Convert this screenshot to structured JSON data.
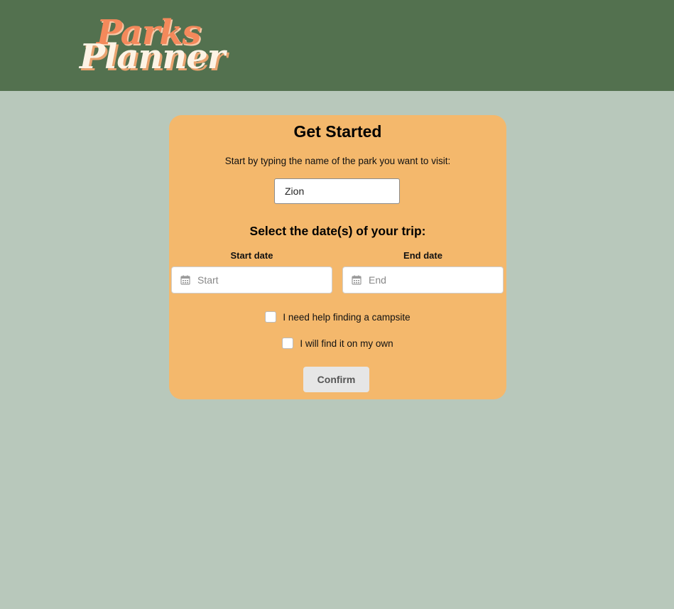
{
  "header": {
    "logo_line1": "Parks",
    "logo_line2": "Planner",
    "background_color": "#53714f"
  },
  "card": {
    "title": "Get Started",
    "subtitle": "Start by typing the name of the park you want to visit:",
    "park_input_value": "Zion",
    "dates_heading": "Select the date(s) of your trip:",
    "start_date_label": "Start date",
    "start_date_placeholder": "Start",
    "end_date_label": "End date",
    "end_date_placeholder": "End",
    "checkbox_help_label": "I need help finding a campsite",
    "checkbox_own_label": "I will find it on my own",
    "confirm_label": "Confirm",
    "background_color": "#f4b86c"
  },
  "icons": {
    "date_field_icon": "calendar-icon"
  }
}
